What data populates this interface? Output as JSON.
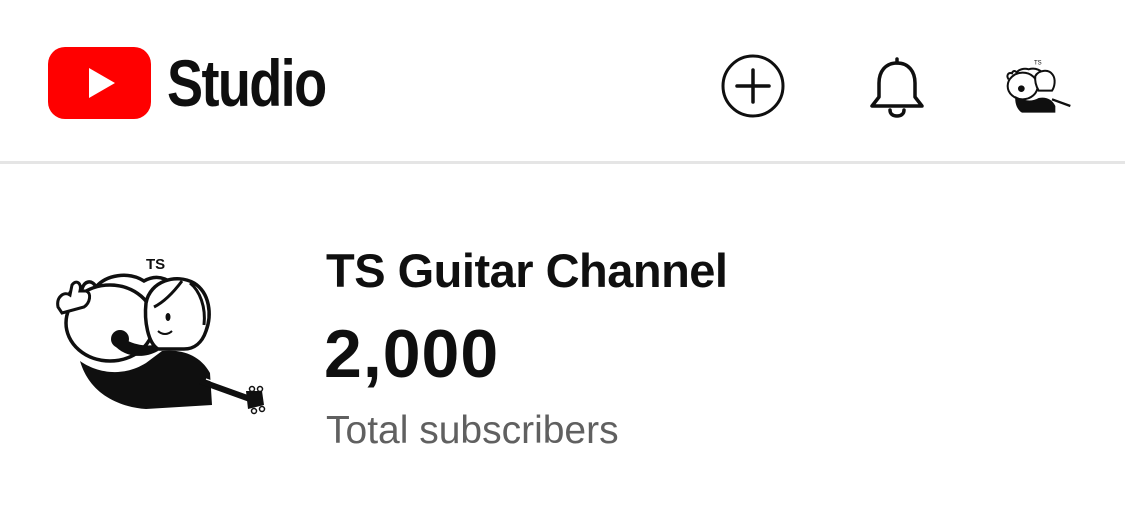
{
  "header": {
    "app_name": "Studio",
    "brand_color": "#ff0000",
    "icons": {
      "logo": "youtube-play-icon",
      "create": "create-plus-icon",
      "notifications": "bell-icon",
      "account": "account-avatar"
    }
  },
  "channel": {
    "avatar_text": "TS",
    "name": "TS Guitar Channel",
    "subscriber_count": "2,000",
    "subscriber_label": "Total subscribers"
  }
}
